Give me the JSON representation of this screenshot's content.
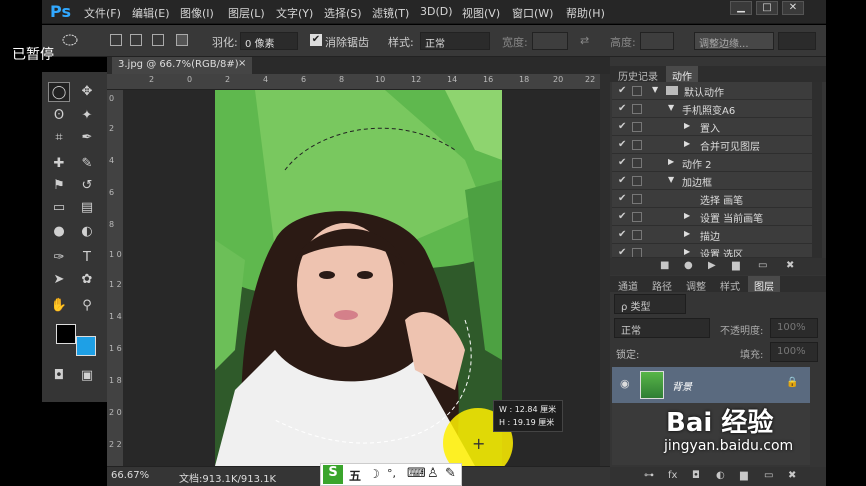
{
  "overlay": {
    "paused_text": "已暂停"
  },
  "app": {
    "logo": "Ps"
  },
  "menubar": {
    "items": [
      "文件(F)",
      "编辑(E)",
      "图像(I)",
      "图层(L)",
      "文字(Y)",
      "选择(S)",
      "滤镜(T)",
      "3D(D)",
      "视图(V)",
      "窗口(W)",
      "帮助(H)"
    ]
  },
  "window_controls": {
    "minimize": "▁",
    "restore": "□",
    "close": "✕"
  },
  "options": {
    "feather_label": "羽化:",
    "feather_value": "0 像素",
    "antialias_label": "消除锯齿",
    "antialias_checked": "✔",
    "style_label": "样式:",
    "style_value": "正常",
    "width_label": "宽度:",
    "height_label": "高度:",
    "swap_icon": "⇄",
    "refine_edge": "调整边缘..."
  },
  "document": {
    "tab_title": "3.jpg @ 66.7%(RGB/8#)",
    "tab_close": "×",
    "zoom": "66.67%",
    "doc_info": "文档:913.1K/913.1K",
    "ruler_top": [
      "2",
      "0",
      "2",
      "4",
      "6",
      "8",
      "10",
      "12",
      "14",
      "16",
      "18",
      "20",
      "22"
    ],
    "ruler_left": [
      "0",
      "2",
      "4",
      "6",
      "8",
      "1 0",
      "1 2",
      "1 4",
      "1 6",
      "1 8",
      "2 0",
      "2 2"
    ]
  },
  "measure": {
    "w": "W :  12.84 厘米",
    "h": "H :  19.19 厘米"
  },
  "ime": {
    "s_logo": "S",
    "wubi": "五",
    "moon": "☽",
    "dots": "°,",
    "keyboard": "⌨",
    "person": "♙",
    "wrench": "✎"
  },
  "tools": {
    "marquee": "◯",
    "move": "✥",
    "lasso": "ʘ",
    "wand": "✦",
    "crop": "⌗",
    "eyedrop": "✒",
    "heal": "✚",
    "brush": "✎",
    "stamp": "⚑",
    "history": "↺",
    "eraser": "▭",
    "gradient": "▤",
    "blur": "●",
    "dodge": "◐",
    "pen": "✑",
    "type": "T",
    "path_select": "➤",
    "shape": "✿",
    "hand": "✋",
    "zoom": "⚲",
    "quickmask": "◘",
    "screenmode": "▣"
  },
  "panels": {
    "top_tabs": {
      "history": "历史记录",
      "actions": "动作"
    },
    "actions": [
      {
        "label": "默认动作",
        "check": "✔",
        "arrow": "▼"
      },
      {
        "label": "手机照变A6",
        "check": "✔",
        "arrow": "▼"
      },
      {
        "label": "置入",
        "check": "✔",
        "arrow": "▶"
      },
      {
        "label": "合并可见图层",
        "check": "✔",
        "arrow": "▶"
      },
      {
        "label": "动作 2",
        "check": "✔",
        "arrow": "▶"
      },
      {
        "label": "加边框",
        "check": "✔",
        "arrow": "▼"
      },
      {
        "label": "选择 画笔",
        "check": "✔",
        "arrow": ""
      },
      {
        "label": "设置 当前画笔",
        "check": "✔",
        "arrow": "▶"
      },
      {
        "label": "描边",
        "check": "✔",
        "arrow": "▶"
      },
      {
        "label": "设置 选区",
        "check": "✔",
        "arrow": "▶"
      }
    ],
    "action_footer": {
      "stop": "■",
      "record": "●",
      "play": "▶",
      "folder": "▆",
      "new": "▭",
      "delete": "✖"
    },
    "layer_tabs": {
      "channels": "通道",
      "paths": "路径",
      "adjust": "调整",
      "styles": "样式",
      "layers": "图层"
    },
    "layers": {
      "kind_label": "ρ 类型",
      "blend_mode": "正常",
      "opacity_label": "不透明度:",
      "opacity_value": "100%",
      "lock_label": "锁定:",
      "fill_label": "填充:",
      "fill_value": "100%",
      "layer_name": "背景",
      "eye": "◉",
      "lock_icon": "🔒",
      "footer": [
        "⊶",
        "fx",
        "◘",
        "◐",
        "▆",
        "▭",
        "✖"
      ]
    }
  },
  "watermark": {
    "brand": "Bai 经验",
    "url": "jingyan.baidu.com"
  },
  "colors": {
    "foreground": "#000000",
    "background": "#1ea0e6",
    "accent": "#31a8ff"
  }
}
